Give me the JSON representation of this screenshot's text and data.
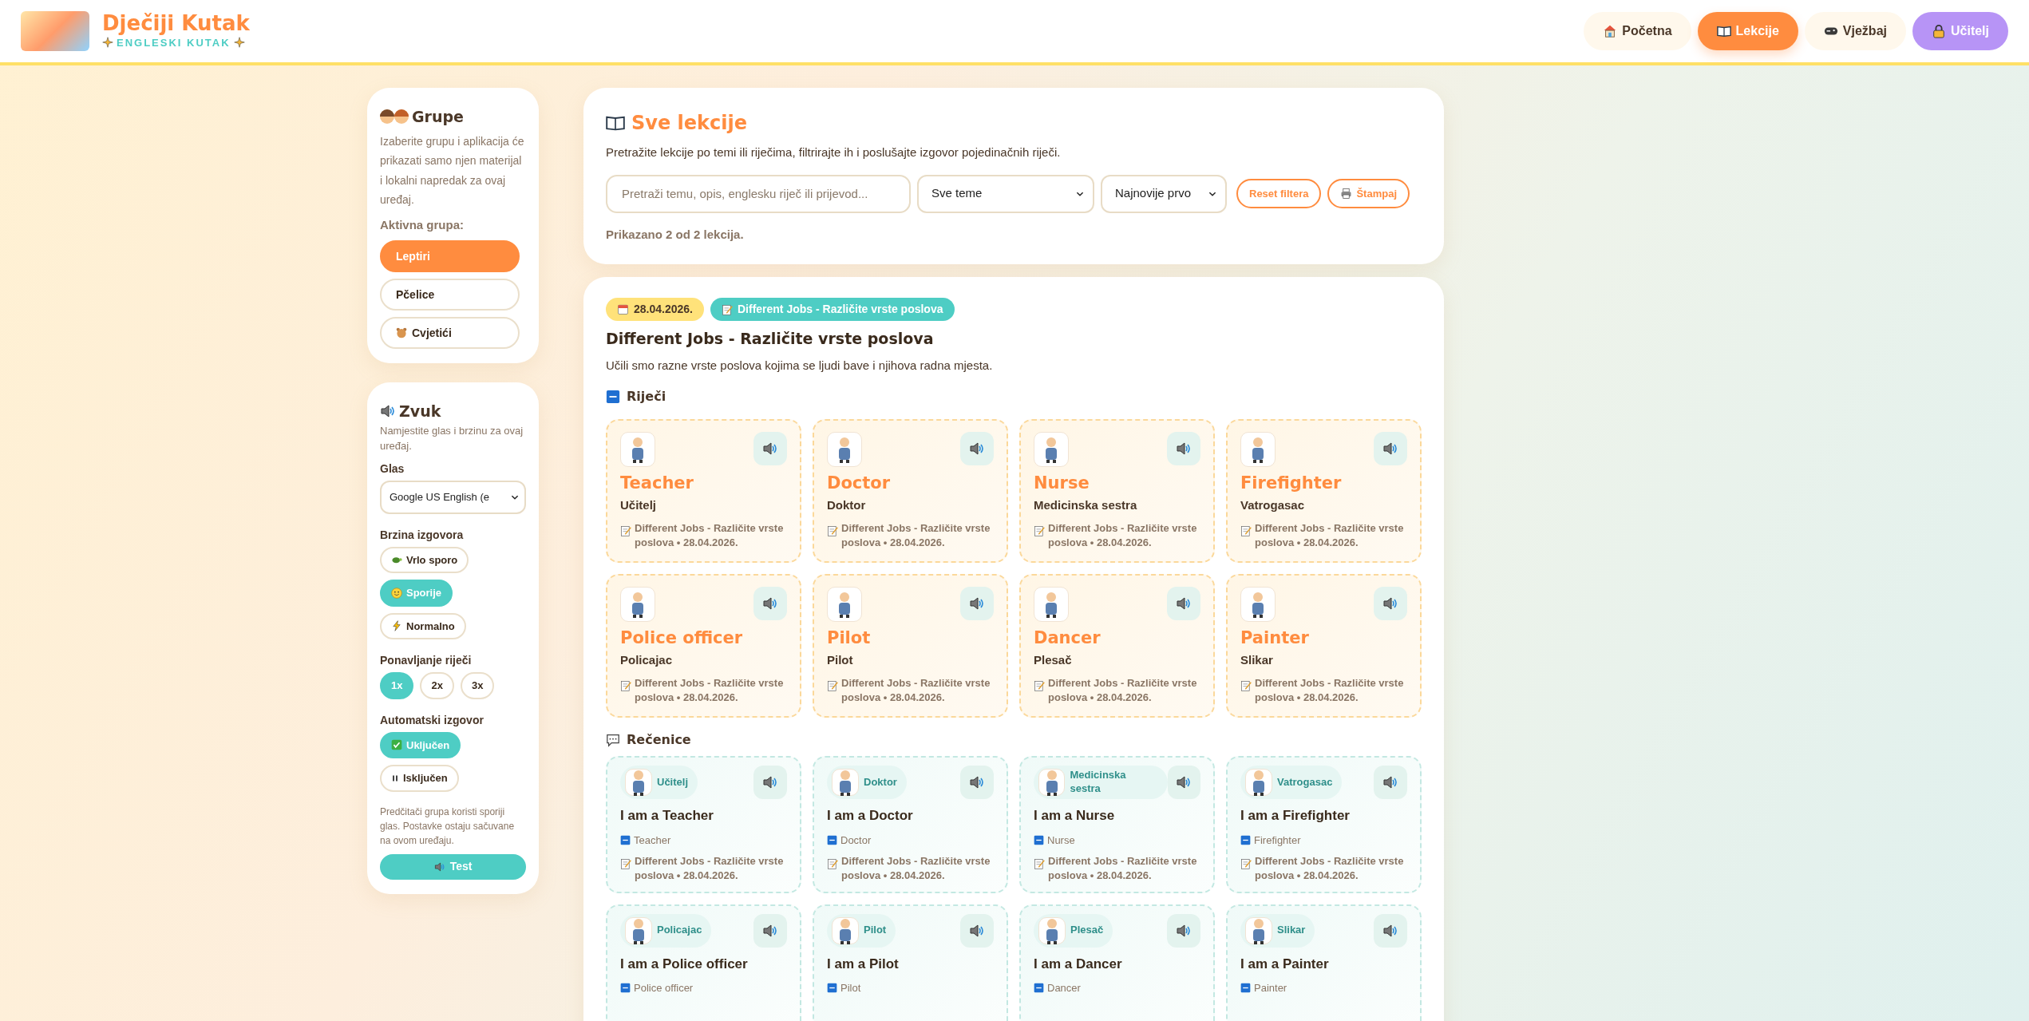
{
  "header": {
    "brand_title": "Dječiji Kutak",
    "brand_subtitle": "ENGLESKI KUTAK",
    "nav": [
      {
        "label": "Početna",
        "kind": "page",
        "selected": false
      },
      {
        "label": "Lekcije",
        "kind": "page",
        "selected": true
      },
      {
        "label": "Vježbaj",
        "kind": "page",
        "selected": false
      },
      {
        "label": "Učitelj",
        "kind": "teacher",
        "selected": false
      }
    ]
  },
  "sidebar": {
    "groups_panel": {
      "title": "Grupe",
      "description": "Izaberite grupu i aplikacija će prikazati samo njen materijal i lokalni napredak za ovaj uređaj.",
      "active_label": "Aktivna grupa:",
      "groups": [
        {
          "label": "Leptiri",
          "selected": true
        },
        {
          "label": "Pčelice",
          "selected": false
        },
        {
          "label": "Cvjetići",
          "selected": false
        }
      ]
    },
    "sound_panel": {
      "title": "Zvuk",
      "description": "Namjestite glas i brzinu za ovaj uređaj.",
      "voice_label": "Glas",
      "voice_value": "Google US English (e",
      "speed_label": "Brzina izgovora",
      "speeds": [
        {
          "label": "Vrlo sporo",
          "selected": false
        },
        {
          "label": "Sporije",
          "selected": true
        },
        {
          "label": "Normalno",
          "selected": false
        }
      ],
      "repeat_label": "Ponavljanje riječi",
      "repeats": [
        {
          "label": "1x",
          "selected": true
        },
        {
          "label": "2x",
          "selected": false
        },
        {
          "label": "3x",
          "selected": false
        }
      ],
      "auto_label": "Automatski izgovor",
      "auto_options": [
        {
          "label": "Uključen",
          "selected": true
        },
        {
          "label": "Isključen",
          "selected": false
        }
      ],
      "note": "Predčitači grupa koristi sporiji glas. Postavke ostaju sačuvane na ovom uređaju.",
      "test_button": "Test"
    }
  },
  "lessons_panel": {
    "title": "Sve lekcije",
    "description": "Pretražite lekcije po temi ili riječima, filtrirajte ih i poslušajte izgovor pojedinačnih riječi.",
    "search": {
      "placeholder": "Pretraži temu, opis, englesku riječ ili prijevod..."
    },
    "topic_select": "Sve teme",
    "sort_select": "Najnovije prvo",
    "reset_button": "Reset filtera",
    "print_button": "Štampaj",
    "result_count": "Prikazano 2 od 2 lekcija."
  },
  "lesson": {
    "date": "28.04.2026.",
    "topic_tag": "Different Jobs - Različite vrste poslova",
    "title": "Different Jobs - Različite vrste poslova",
    "description": "Učili smo razne vrste poslova kojima se ljudi bave i njihova radna mjesta.",
    "words_heading": "Riječi",
    "words": [
      {
        "english": "Teacher",
        "translation": "Učitelj",
        "meta": "Different Jobs - Različite vrste poslova • 28.04.2026."
      },
      {
        "english": "Doctor",
        "translation": "Doktor",
        "meta": "Different Jobs - Različite vrste poslova • 28.04.2026."
      },
      {
        "english": "Nurse",
        "translation": "Medicinska sestra",
        "meta": "Different Jobs - Različite vrste poslova • 28.04.2026."
      },
      {
        "english": "Firefighter",
        "translation": "Vatrogasac",
        "meta": "Different Jobs - Različite vrste poslova • 28.04.2026."
      },
      {
        "english": "Police officer",
        "translation": "Policajac",
        "meta": "Different Jobs - Različite vrste poslova • 28.04.2026."
      },
      {
        "english": "Pilot",
        "translation": "Pilot",
        "meta": "Different Jobs - Različite vrste poslova • 28.04.2026."
      },
      {
        "english": "Dancer",
        "translation": "Plesač",
        "meta": "Different Jobs - Različite vrste poslova • 28.04.2026."
      },
      {
        "english": "Painter",
        "translation": "Slikar",
        "meta": "Different Jobs - Različite vrste poslova • 28.04.2026."
      }
    ],
    "sentences_heading": "Rečenice",
    "sentences": [
      {
        "chip": "Učitelj",
        "sentence": "I am a Teacher",
        "english_word": "Teacher",
        "meta": "Different Jobs - Različite vrste poslova • 28.04.2026."
      },
      {
        "chip": "Doktor",
        "sentence": "I am a Doctor",
        "english_word": "Doctor",
        "meta": "Different Jobs - Različite vrste poslova • 28.04.2026."
      },
      {
        "chip": "Medicinska sestra",
        "sentence": "I am a Nurse",
        "english_word": "Nurse",
        "meta": "Different Jobs - Različite vrste poslova • 28.04.2026."
      },
      {
        "chip": "Vatrogasac",
        "sentence": "I am a Firefighter",
        "english_word": "Firefighter",
        "meta": "Different Jobs - Različite vrste poslova • 28.04.2026."
      },
      {
        "chip": "Policajac",
        "sentence": "I am a Police officer",
        "english_word": "Police officer"
      },
      {
        "chip": "Pilot",
        "sentence": "I am a Pilot",
        "english_word": "Pilot"
      },
      {
        "chip": "Plesač",
        "sentence": "I am a Dancer",
        "english_word": "Dancer"
      },
      {
        "chip": "Slikar",
        "sentence": "I am a Painter",
        "english_word": "Painter"
      }
    ]
  }
}
